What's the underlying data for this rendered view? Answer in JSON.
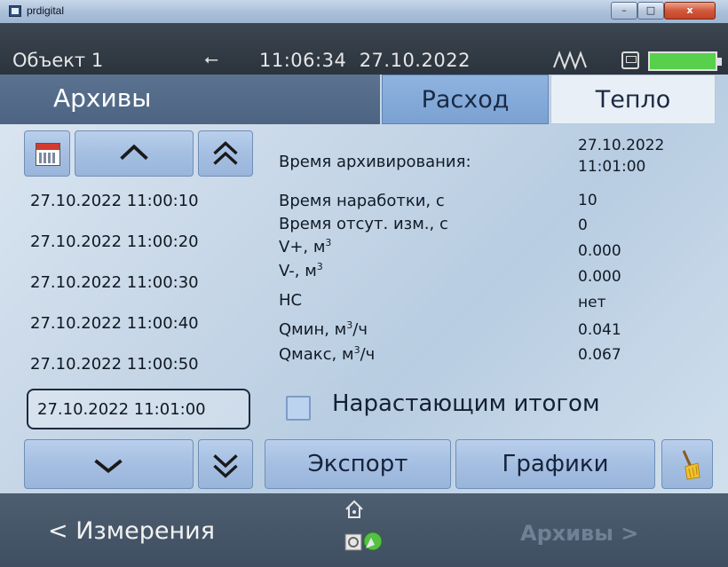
{
  "window": {
    "title": "prdigital",
    "minimize_glyph": "–",
    "maximize_glyph": "□",
    "close_glyph": "x"
  },
  "status": {
    "object": "Объект 1",
    "usb_icon": "usb-icon",
    "time": "11:06:34",
    "date": "27.10.2022",
    "battery_color": "#58d04b"
  },
  "header": {
    "title": "Архивы",
    "tabs": [
      {
        "label": "Расход",
        "active": true
      },
      {
        "label": "Тепло",
        "active": false
      }
    ]
  },
  "archive_list": {
    "items": [
      "27.10.2022 11:00:10",
      "27.10.2022 11:00:20",
      "27.10.2022 11:00:30",
      "27.10.2022 11:00:40",
      "27.10.2022 11:00:50",
      "27.10.2022 11:01:00"
    ],
    "selected": "27.10.2022 11:01:00"
  },
  "details": {
    "archive_time_label": "Время архивирования:",
    "archive_date": "27.10.2022",
    "archive_time": "11:01:00",
    "fields": [
      {
        "label": "Время наработки, с",
        "value": "10"
      },
      {
        "label": "Время отсут. изм., с",
        "value": "0"
      },
      {
        "label": "V+, м",
        "unit_sup": "3",
        "value": "0.000"
      },
      {
        "label": "V-, м",
        "unit_sup": "3",
        "value": "0.000"
      },
      {
        "label": "НС",
        "value": "нет"
      },
      {
        "label": "Qмин, м",
        "unit_sup": "3",
        "unit_tail": "/ч",
        "value": "0.041"
      },
      {
        "label": "Qмакс, м",
        "unit_sup": "3",
        "unit_tail": "/ч",
        "value": "0.067"
      }
    ]
  },
  "cumulative": {
    "label": "Нарастающим итогом",
    "checked": false
  },
  "actions": {
    "export": "Экспорт",
    "graphs": "Графики"
  },
  "footer": {
    "back": "< Измерения",
    "forward": "Архивы >"
  }
}
